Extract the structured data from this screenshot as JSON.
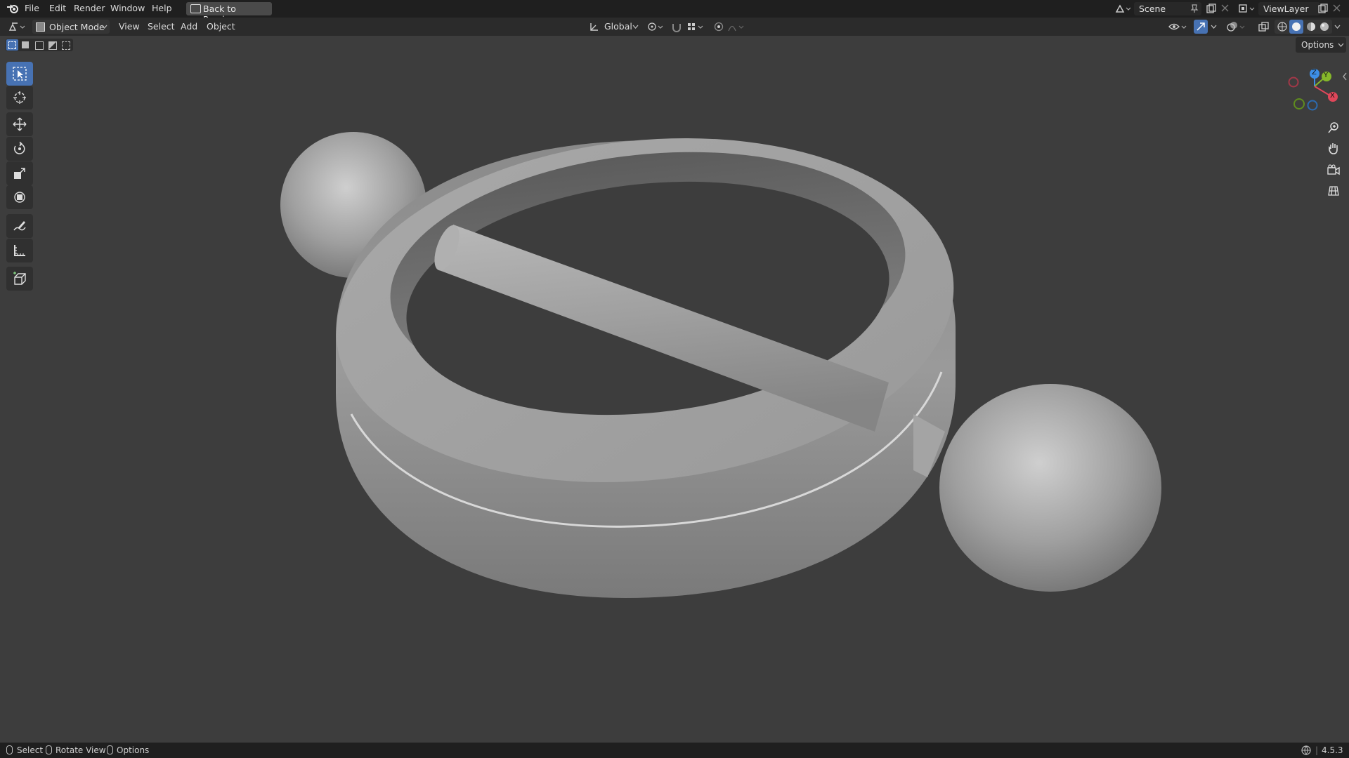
{
  "topbar": {
    "menus": [
      "File",
      "Edit",
      "Render",
      "Window",
      "Help"
    ],
    "back_button": "Back to Previous",
    "scene": "Scene",
    "view_layer": "ViewLayer"
  },
  "header": {
    "mode": "Object Mode",
    "menus": [
      "View",
      "Select",
      "Add",
      "Object"
    ],
    "transform_orientation": "Global",
    "options": "Options"
  },
  "toolbar": {
    "tools": [
      "select-box",
      "cursor",
      "move",
      "rotate",
      "scale",
      "transform",
      "annotate",
      "measure",
      "add-cube"
    ],
    "active_tool": "select-box"
  },
  "status": {
    "hints": [
      "Select",
      "Rotate View",
      "Options"
    ],
    "version": "4.5.3"
  },
  "gizmo": {
    "axes": [
      "X",
      "Y",
      "Z"
    ],
    "colors": {
      "x": "#e0475a",
      "y": "#86b82a",
      "z": "#3d8ee6"
    }
  },
  "colors": {
    "viewport_bg": "#3d3d3d",
    "accent": "#4772b3",
    "mesh": "#9a9a9a"
  }
}
